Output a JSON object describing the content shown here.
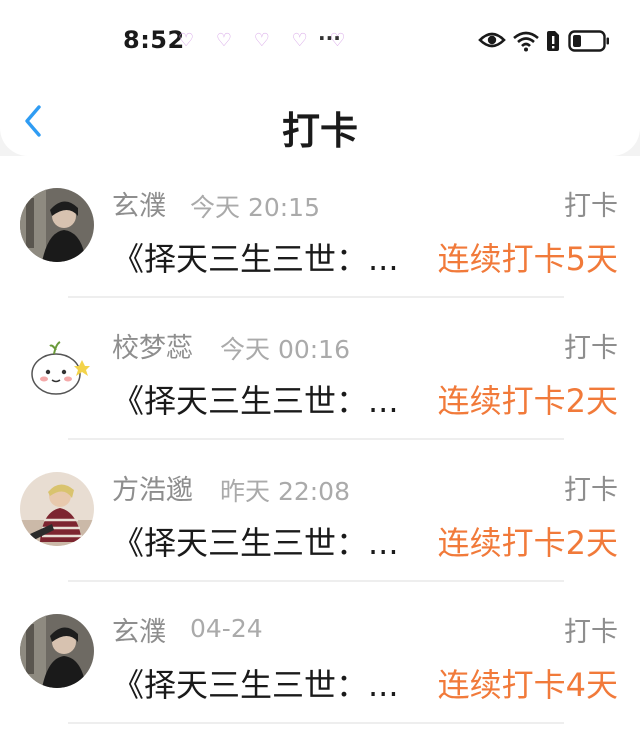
{
  "status_bar": {
    "time": "8:52",
    "notification_icons": "♡ ♡ ♡ ♡ ♡",
    "more": "···",
    "icons": [
      "eye-icon",
      "wifi-icon",
      "sim-alert-icon",
      "battery-icon"
    ]
  },
  "header": {
    "title": "打卡",
    "back_icon": "chevron-left-icon"
  },
  "colors": {
    "accent_back": "#2f9cf3",
    "streak": "#f17a3a"
  },
  "items": [
    {
      "name": "玄濮",
      "time": "今天 20:15",
      "type": "打卡",
      "book": "《择天三生三世：...",
      "streak": "连续打卡5天"
    },
    {
      "name": "校梦蕊",
      "time": "今天 00:16",
      "type": "打卡",
      "book": "《择天三生三世：...",
      "streak": "连续打卡2天"
    },
    {
      "name": "方浩邈",
      "time": "昨天 22:08",
      "type": "打卡",
      "book": "《择天三生三世：...",
      "streak": "连续打卡2天"
    },
    {
      "name": "玄濮",
      "time": "04-24",
      "type": "打卡",
      "book": "《择天三生三世：...",
      "streak": "连续打卡4天"
    }
  ]
}
